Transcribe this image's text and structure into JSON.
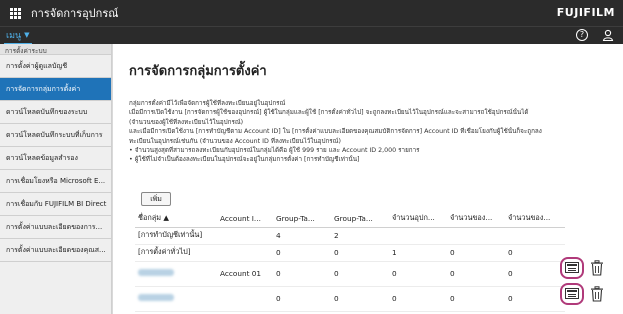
{
  "header": {
    "app_title": "การจัดการอุปกรณ์",
    "brand": "FUJIFILM",
    "menu_label": "เมนู"
  },
  "sidebar": {
    "section": "การตั้งค่าระบบ",
    "items": [
      {
        "label": "การตั้งค่าผู้ดูแลบัญชี"
      },
      {
        "label": "การจัดการกลุ่มการตั้งค่า"
      },
      {
        "label": "ดาวน์โหลดบันทึกของระบบ"
      },
      {
        "label": "ดาวน์โหลดบันทึกระบบที่เก็บการ"
      },
      {
        "label": "ดาวน์โหลดข้อมูลสำรอง"
      },
      {
        "label": "การเชื่อมโยงหรือ Microsoft E..."
      },
      {
        "label": "การเชื่อมกับ FUJIFILM BI Direct"
      },
      {
        "label": "การตั้งค่าแบบละเอียดของการ..."
      },
      {
        "label": "การตั้งค่าแบบละเอียดของคุณส..."
      }
    ]
  },
  "main": {
    "title": "การจัดการกลุ่มการตั้งค่า",
    "description": [
      "กลุ่มการตั้งค่ามีไว้เพื่อจัดการผู้ใช้ที่ลงทะเบียนอยู่ในอุปกรณ์",
      "เมื่อมีการเปิดใช้งาน [การจัดการผู้ใช้ของอุปกรณ์] ผู้ใช้ในกลุ่มและผู้ใช้ [การตั้งค่าทั่วไป] จะถูกลงทะเบียนไว้ในอุปกรณ์และจะสามารถใช้อุปกรณ์นั้นได้",
      "(จำนวนของผู้ใช้ที่ลงทะเบียนไว้ในอุปกรณ์)",
      "และเมื่อมีการเปิดใช้งาน [การทำบัญชีตาม Account ID] ใน [การตั้งค่าแบบละเอียดของคุณสมบัติการจัดการ] Account ID ที่เชื่อมโยงกับผู้ใช้นั้นก็จะถูกลง",
      "ทะเบียนในอุปกรณ์เช่นกัน (จำนวนของ Account ID ที่ลงทะเบียนไว้ในอุปกรณ์)",
      "• จำนวนสูงสุดที่สามารถลงทะเบียนกับอุปกรณ์ในกลุ่มได้คือ ผู้ใช้ 999 ราย และ Account ID 2,000 รายการ",
      "• ผู้ใช้ที่ไม่จำเป็นต้องลงทะเบียนในอุปกรณ์จะอยู่ในกลุ่มการตั้งค่า [การทำบัญชีเท่านั้น]"
    ],
    "add_button": "เพิ่ม",
    "table": {
      "columns": [
        "ชื่อกลุ่ม ▲",
        "Account I...",
        "Group-Ta...",
        "Group-Ta...",
        "จำนวนอุปก...",
        "จำนวนของ...",
        "จำนวนของ..."
      ],
      "rows": [
        [
          "[การทำบัญชีเท่านั้น]",
          "",
          "4",
          "2",
          "",
          "",
          ""
        ],
        [
          "[การตั้งค่าทั่วไป]",
          "",
          "0",
          "0",
          "1",
          "0",
          "0"
        ],
        [
          "",
          "Account 01",
          "0",
          "0",
          "0",
          "0",
          "0"
        ],
        [
          "",
          "",
          "0",
          "0",
          "0",
          "0",
          "0"
        ]
      ]
    }
  },
  "icons": {
    "apps": "grid-icon",
    "help": "help-icon",
    "user": "user-icon",
    "edit": "card-icon",
    "delete": "trash-icon"
  },
  "colors": {
    "topbar": "#2b2b2b",
    "accent": "#4fb0e8",
    "active_item": "#1f73b8",
    "highlight_ring": "#b03a7a"
  }
}
